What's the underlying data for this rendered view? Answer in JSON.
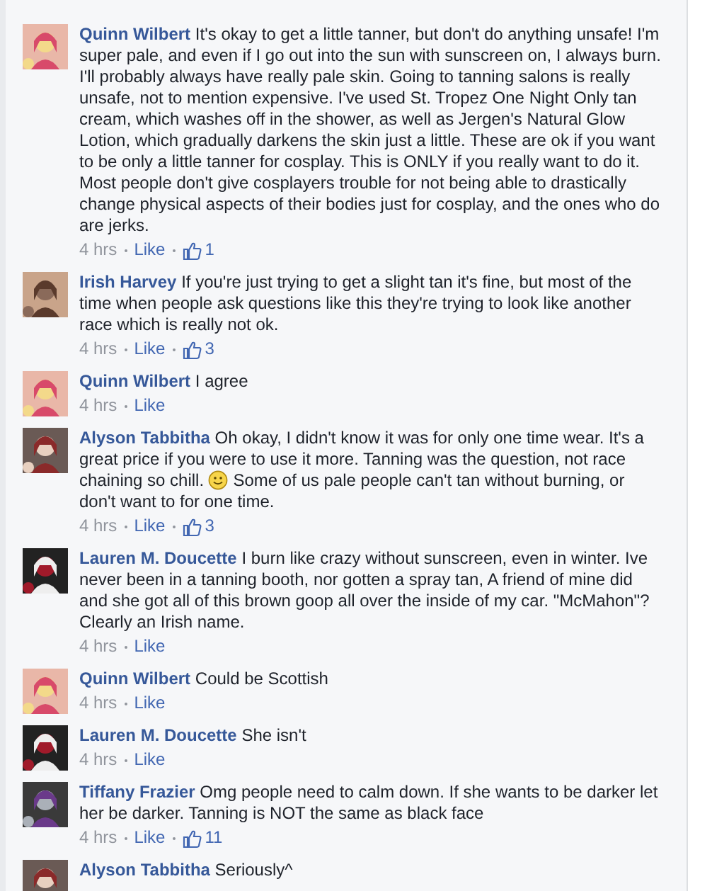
{
  "comments": [
    {
      "author": "Quinn Wilbert",
      "segments": [
        {
          "kind": "text",
          "text": "It's okay to get a little tanner, but don't do anything unsafe! I'm super pale, and even if I go out into the sun with sunscreen on, I always burn. I'll probably always have really pale skin. Going to tanning salons is really unsafe, not to mention expensive. I've used St. Tropez One Night Only tan cream, which washes off in the shower, as well as Jergen's Natural Glow Lotion, which gradually darkens the skin just a little. These are ok if you want to be only a little tanner for cosplay. This is ONLY if you really want to do it. Most people don't give cosplayers trouble for not being able to drastically change physical aspects of their bodies just for cosplay, and the ones who do are jerks."
        }
      ],
      "time": "4 hrs",
      "like": "Like",
      "likes": "1"
    },
    {
      "author": "Irish Harvey",
      "segments": [
        {
          "kind": "text",
          "text": "If you're just trying to get a slight tan it's fine, but most of the time when people ask questions like this they're trying to look like another race which is really not ok."
        }
      ],
      "time": "4 hrs",
      "like": "Like",
      "likes": "3"
    },
    {
      "author": "Quinn Wilbert",
      "segments": [
        {
          "kind": "text",
          "text": "I agree"
        }
      ],
      "time": "4 hrs",
      "like": "Like"
    },
    {
      "author": "Alyson Tabbitha",
      "segments": [
        {
          "kind": "text",
          "text": "Oh okay, I didn't know it was for only one time wear. It's a great price if you were to use it more. Tanning was the question, not race chaining so chill. "
        },
        {
          "kind": "smiley"
        },
        {
          "kind": "text",
          "text": " Some of us pale people can't tan without burning, or don't want to for one time."
        }
      ],
      "time": "4 hrs",
      "like": "Like",
      "likes": "3"
    },
    {
      "author": "Lauren M. Doucette",
      "segments": [
        {
          "kind": "text",
          "text": "I burn like crazy without sunscreen, even in winter. Ive never been in a tanning booth, nor gotten a spray tan, A friend of mine did and she got all of this brown goop all over the inside of my car. \"McMahon\"? Clearly an Irish name."
        }
      ],
      "time": "4 hrs",
      "like": "Like"
    },
    {
      "author": "Quinn Wilbert",
      "segments": [
        {
          "kind": "text",
          "text": "Could be Scottish"
        }
      ],
      "time": "4 hrs",
      "like": "Like"
    },
    {
      "author": "Lauren M. Doucette",
      "segments": [
        {
          "kind": "text",
          "text": "She isn't"
        }
      ],
      "time": "4 hrs",
      "like": "Like"
    },
    {
      "author": "Tiffany Frazier",
      "segments": [
        {
          "kind": "text",
          "text": "Omg people need to calm down. If she wants to be darker let her be darker. Tanning is NOT the same as black face"
        }
      ],
      "time": "4 hrs",
      "like": "Like",
      "likes": "11"
    },
    {
      "author": "Alyson Tabbitha",
      "segments": [
        {
          "kind": "text",
          "text": "Seriously^"
        }
      ]
    }
  ]
}
